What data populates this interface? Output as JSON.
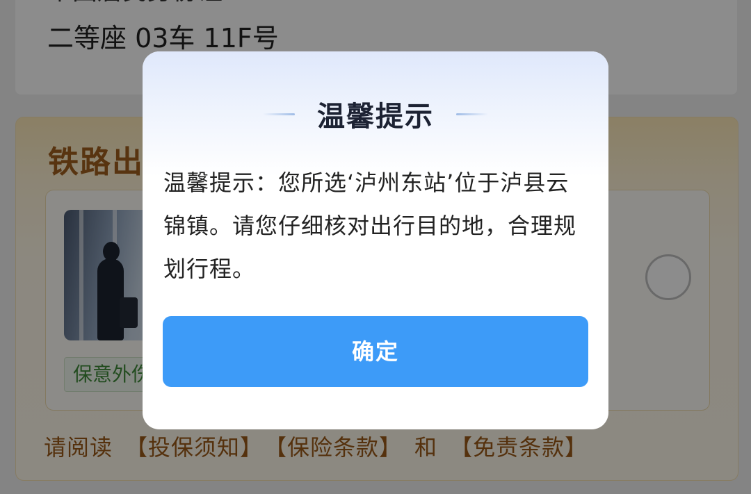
{
  "ticket": {
    "cutoff_text": "中国居民身份证",
    "seat": "二等座 03车 11F号"
  },
  "insurance": {
    "title": "铁路出",
    "tag": "保意外伤",
    "terms_prefix": "请阅读",
    "terms_links": [
      "【投保须知】",
      "【保险条款】"
    ],
    "terms_and": "和",
    "terms_last": "【免责条款】"
  },
  "dialog": {
    "title": "温馨提示",
    "message": "温馨提示：您所选‘泸州东站’位于泸县云锦镇。请您仔细核对出行目的地，合理规划行程。",
    "confirm_label": "确定"
  },
  "colors": {
    "confirm_button": "#3d9bf8",
    "overlay": "rgba(0,0,0,0.45)",
    "insurance_text": "#9b5a19"
  }
}
